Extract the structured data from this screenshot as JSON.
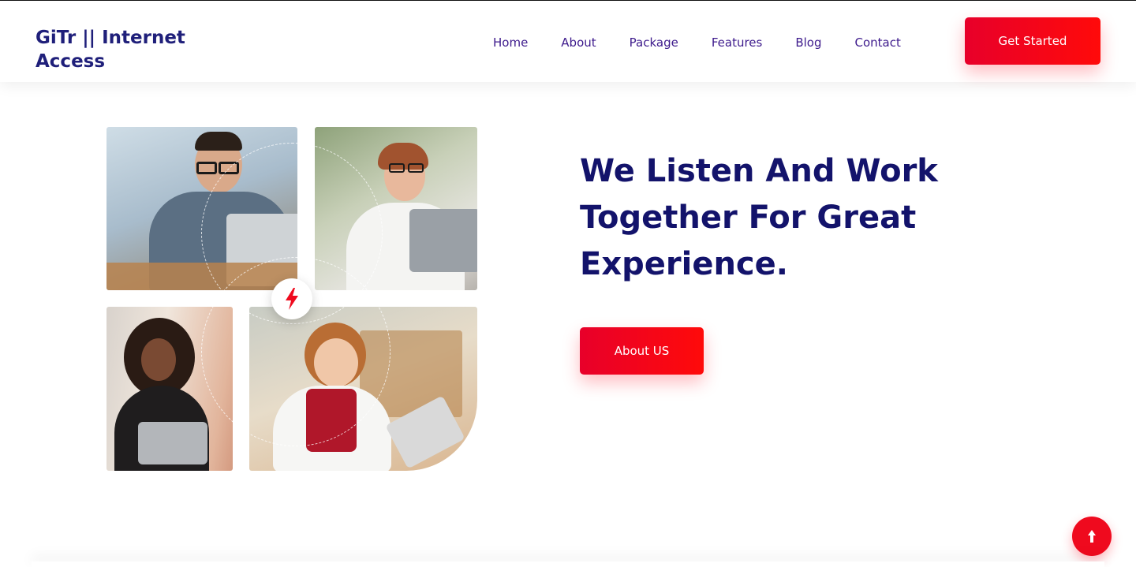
{
  "header": {
    "brand": "GiTr || Internet Access",
    "nav": [
      "Home",
      "About",
      "Package",
      "Features",
      "Blog",
      "Contact"
    ],
    "cta_label": "Get Started"
  },
  "hero": {
    "headline": "We Listen And Work Together For Great Experience.",
    "button_label": "About US",
    "center_icon": "lightning-bolt-icon"
  },
  "scroll_top_icon": "arrow-up-icon",
  "colors": {
    "brand_text": "#1f1f7a",
    "nav_text": "#3d1a8c",
    "headline": "#13136b",
    "accent_red": "#ef0a1e"
  }
}
